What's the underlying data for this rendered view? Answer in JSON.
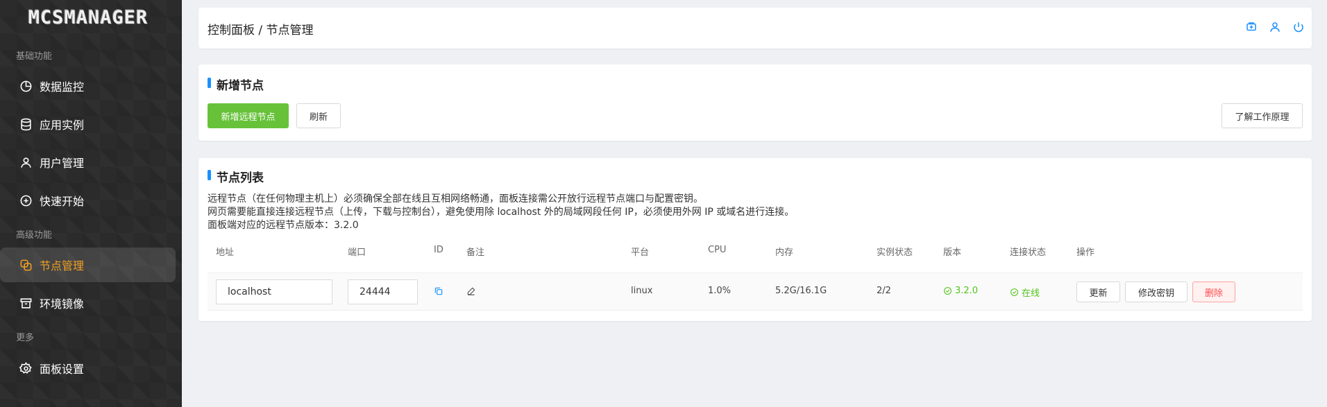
{
  "app": {
    "logo_text": "MCSMANAGER"
  },
  "sidebar": {
    "groups": [
      {
        "title": "基础功能"
      },
      {
        "title": "高级功能"
      },
      {
        "title": "更多"
      }
    ],
    "items": [
      {
        "label": "数据监控",
        "icon": "pie-chart-icon"
      },
      {
        "label": "应用实例",
        "icon": "database-icon"
      },
      {
        "label": "用户管理",
        "icon": "user-icon"
      },
      {
        "label": "快速开始",
        "icon": "plus-circle-icon"
      },
      {
        "label": "节点管理",
        "icon": "nodes-icon",
        "active": true
      },
      {
        "label": "环境镜像",
        "icon": "box-icon"
      },
      {
        "label": "面板设置",
        "icon": "gear-icon"
      }
    ]
  },
  "header": {
    "breadcrumb": "控制面板 / 节点管理",
    "icons": [
      "docs-icon",
      "user-icon",
      "power-icon"
    ]
  },
  "add_node": {
    "title": "新增节点",
    "add_button": "新增远程节点",
    "refresh_button": "刷新",
    "learn_button": "了解工作原理"
  },
  "node_list": {
    "title": "节点列表",
    "desc_line1": "远程节点（在任何物理主机上）必须确保全部在线且互相网络畅通，面板连接需公开放行远程节点端口与配置密钥。",
    "desc_line2": "网页需要能直接连接远程节点（上传，下载与控制台），避免使用除 localhost 外的局域网段任何 IP，必须使用外网 IP 或域名进行连接。",
    "desc_line3": "面板端对应的远程节点版本：3.2.0",
    "columns": {
      "address": "地址",
      "port": "端口",
      "id": "ID",
      "remark": "备注",
      "platform": "平台",
      "cpu": "CPU",
      "memory": "内存",
      "instances": "实例状态",
      "version": "版本",
      "connection": "连接状态",
      "actions": "操作"
    },
    "row": {
      "address": "localhost",
      "port": "24444",
      "platform": "linux",
      "cpu": "1.0%",
      "memory": "5.2G/16.1G",
      "instances": "2/2",
      "version": "3.2.0",
      "connection": "在线",
      "update_button": "更新",
      "change_key_button": "修改密钥",
      "delete_button": "删除"
    }
  },
  "colors": {
    "accent": "#1890ff",
    "success": "#52c41a",
    "primary_button": "#67c23a",
    "sidebar_bg": "#2b2b2b",
    "active_nav": "#f0a020",
    "danger": "#ff4d4f"
  }
}
